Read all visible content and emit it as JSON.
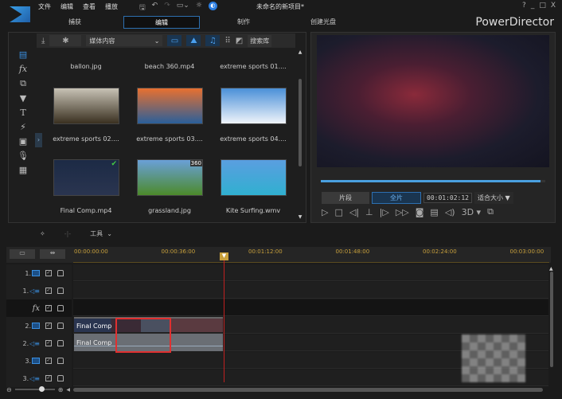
{
  "app": {
    "title": "未命名的新项目*",
    "brand": "PowerDirector",
    "accent": "#2d6fb0"
  },
  "menu": [
    "文件",
    "编辑",
    "查看",
    "播放"
  ],
  "window_controls": [
    "?",
    "_",
    "□",
    "X"
  ],
  "tabs": [
    {
      "label": "捕获"
    },
    {
      "label": "编辑",
      "active": true
    },
    {
      "label": "制作"
    },
    {
      "label": "创建光盘"
    }
  ],
  "library": {
    "dropdown": "媒体内容",
    "search_label": "搜索库",
    "items": [
      {
        "name": "ballon.jpg",
        "colors": [
          "#556030",
          "#8a9040"
        ]
      },
      {
        "name": "beach 360.mp4",
        "colors": [
          "#334",
          "#556"
        ]
      },
      {
        "name": "extreme sports 01....",
        "colors": [
          "#444",
          "#776"
        ]
      },
      {
        "name": "extreme sports 02....",
        "colors": [
          "#c7c2b5",
          "#3a3020"
        ]
      },
      {
        "name": "extreme sports 03....",
        "colors": [
          "#e87030",
          "#2a5f9a"
        ]
      },
      {
        "name": "extreme sports 04....",
        "colors": [
          "#4a90d8",
          "#f0f4fa"
        ]
      },
      {
        "name": "Final Comp.mp4",
        "colors": [
          "#1c2a45",
          "#2a3550"
        ],
        "checked": true
      },
      {
        "name": "grassland.jpg",
        "colors": [
          "#6aa0d8",
          "#4c8a2a"
        ],
        "badge": "360"
      },
      {
        "name": "Kite Surfing.wmv",
        "colors": [
          "#5a9ee0",
          "#30b0d0"
        ]
      }
    ]
  },
  "preview": {
    "segment_tab": "片段",
    "full_tab": "全片",
    "timecode": "00:01:02:12",
    "fit": "适合大小",
    "stereo": "3D",
    "progress": 0.98
  },
  "toolbar": {
    "tools_label": "工具"
  },
  "timeline": {
    "ticks": [
      "00:00:00:00",
      "00:00:36:00",
      "00:01:12:00",
      "00:01:48:00",
      "00:02:24:00",
      "00:03:00:00"
    ],
    "playhead": "00:01:02:12",
    "tracks": [
      {
        "num": "1.",
        "type": "video"
      },
      {
        "num": "1.",
        "type": "audio"
      },
      {
        "num": "",
        "type": "fx",
        "label": "fx"
      },
      {
        "num": "2.",
        "type": "video"
      },
      {
        "num": "2.",
        "type": "audio"
      },
      {
        "num": "3.",
        "type": "video"
      },
      {
        "num": "3.",
        "type": "audio"
      }
    ],
    "clips": {
      "video": "Final Comp",
      "audio": "Final Comp"
    }
  }
}
